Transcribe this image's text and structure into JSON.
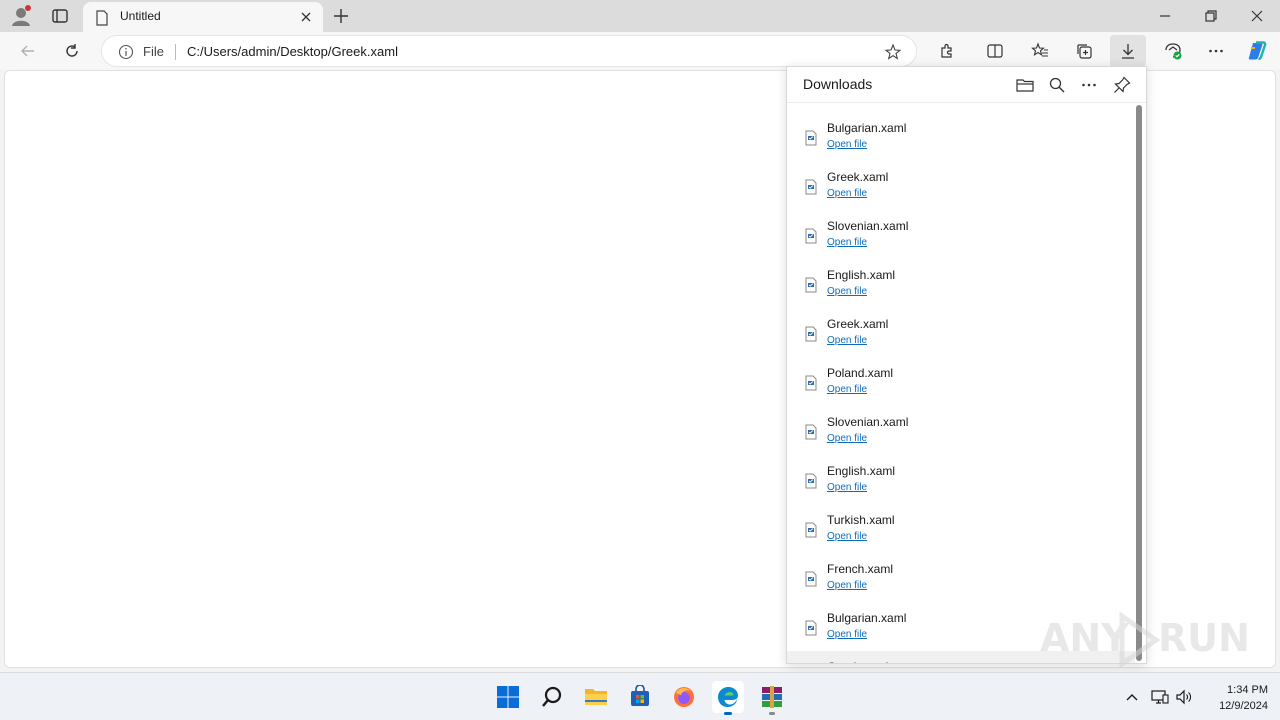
{
  "browser": {
    "tab": {
      "title": "Untitled"
    },
    "address": {
      "scheme_label": "File",
      "url": "C:/Users/admin/Desktop/Greek.xaml"
    }
  },
  "downloads": {
    "title": "Downloads",
    "items": [
      {
        "name": "Bulgarian.xaml",
        "action": "Open file"
      },
      {
        "name": "Greek.xaml",
        "action": "Open file"
      },
      {
        "name": "Slovenian.xaml",
        "action": "Open file"
      },
      {
        "name": "English.xaml",
        "action": "Open file"
      },
      {
        "name": "Greek.xaml",
        "action": "Open file"
      },
      {
        "name": "Poland.xaml",
        "action": "Open file"
      },
      {
        "name": "Slovenian.xaml",
        "action": "Open file"
      },
      {
        "name": "English.xaml",
        "action": "Open file"
      },
      {
        "name": "Turkish.xaml",
        "action": "Open file"
      },
      {
        "name": "French.xaml",
        "action": "Open file"
      },
      {
        "name": "Bulgarian.xaml",
        "action": "Open file"
      },
      {
        "name": "Greek.xaml",
        "action": ""
      }
    ]
  },
  "watermark": {
    "text_left": "ANY",
    "text_right": "RUN"
  },
  "taskbar": {
    "time": "1:34 PM",
    "date": "12/9/2024"
  },
  "colors": {
    "accent": "#0067c0",
    "link": "#0f6cbd",
    "notification_dot": "#d13438"
  }
}
